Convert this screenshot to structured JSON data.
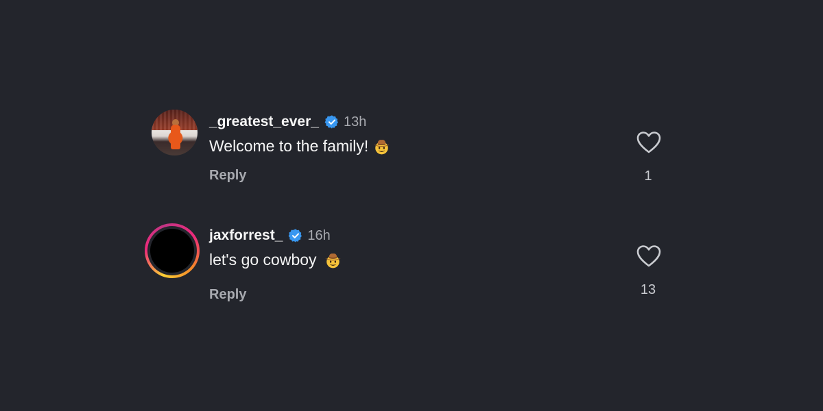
{
  "comments": [
    {
      "username": "_greatest_ever_",
      "verified": true,
      "timestamp": "13h",
      "text": "Welcome to the family!",
      "emoji": "cowboy-hat-face",
      "reply_label": "Reply",
      "like_count": "1",
      "avatar_style": "photo"
    },
    {
      "username": "jaxforrest_",
      "verified": true,
      "timestamp": "16h",
      "text": "let's go cowboy",
      "emoji": "cowboy-hat-face",
      "reply_label": "Reply",
      "like_count": "13",
      "avatar_style": "story-ring"
    }
  ],
  "colors": {
    "background": "#23252c",
    "verified_blue": "#3897f0",
    "secondary_text": "#a8aab0",
    "primary_text": "#f5f5f5"
  }
}
